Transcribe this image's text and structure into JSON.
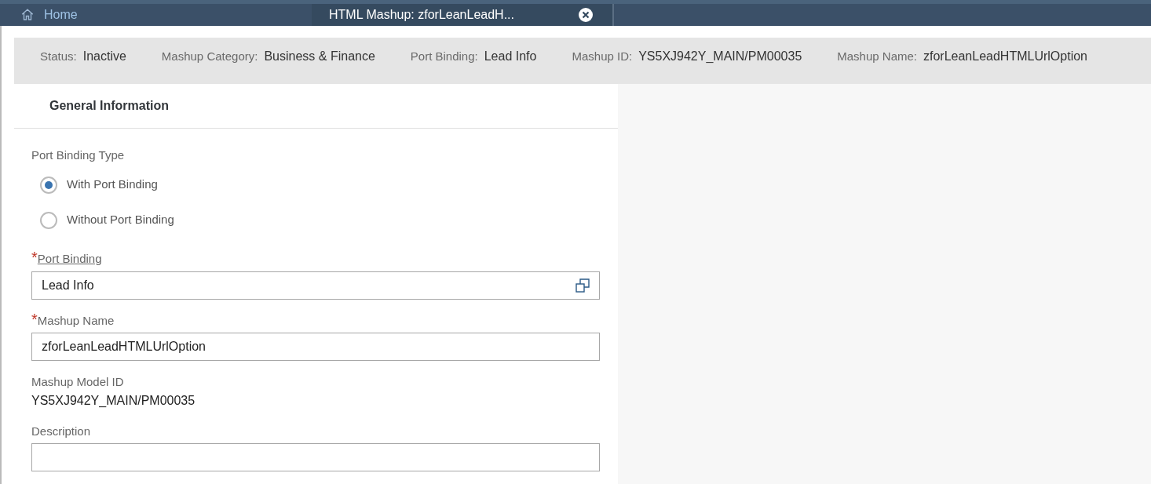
{
  "tabs": [
    {
      "label": "Home",
      "kind": "home",
      "selected": false
    },
    {
      "label": "HTML Mashup: zforLeanLeadH...",
      "kind": "document",
      "selected": true
    }
  ],
  "header": [
    {
      "label": "Status:",
      "value": "Inactive"
    },
    {
      "label": "Mashup Category:",
      "value": "Business & Finance"
    },
    {
      "label": "Port Binding:",
      "value": "Lead Info"
    },
    {
      "label": "Mashup ID:",
      "value": "YS5XJ942Y_MAIN/PM00035"
    },
    {
      "label": "Mashup Name:",
      "value": "zforLeanLeadHTMLUrlOption"
    }
  ],
  "section_title": "General Information",
  "fields": [
    {
      "kind": "radio",
      "label": "Port Binding Type",
      "options": [
        {
          "label": "With Port Binding",
          "selected": true
        },
        {
          "label": "Without Port Binding",
          "selected": false
        }
      ]
    },
    {
      "kind": "input",
      "required_mark": "*",
      "label": "Port Binding",
      "link": true,
      "value": "Lead Info",
      "value_help": true
    },
    {
      "kind": "input",
      "required_mark": "*",
      "label": "Mashup Name",
      "link": false,
      "value": "zforLeanLeadHTMLUrlOption",
      "value_help": false
    },
    {
      "kind": "text",
      "label": "Mashup Model ID",
      "value": "YS5XJ942Y_MAIN/PM00035"
    },
    {
      "kind": "input",
      "label": "Description",
      "link": false,
      "value_help": false
    }
  ]
}
